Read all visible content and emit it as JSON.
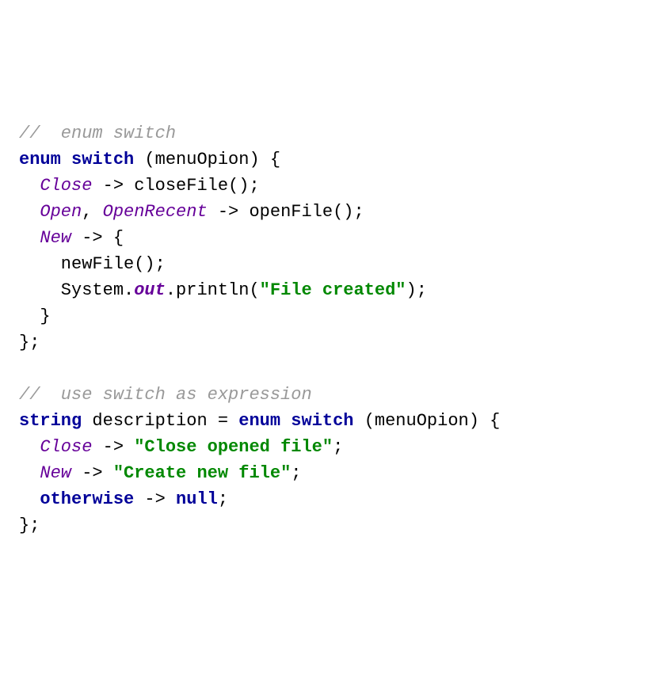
{
  "code": {
    "comment1": "//  enum switch",
    "line2_kw1": "enum",
    "line2_kw2": "switch",
    "line2_rest": " (menuOpion) {",
    "line3_enum": "Close",
    "line3_rest": " -> closeFile();",
    "line4_enum1": "Open",
    "line4_sep": ", ",
    "line4_enum2": "OpenRecent",
    "line4_rest": " -> openFile();",
    "line5_enum": "New",
    "line5_rest": " -> {",
    "line6": "    newFile();",
    "line7_pre": "    System.",
    "line7_field": "out",
    "line7_mid": ".println(",
    "line7_str": "\"File created\"",
    "line7_end": ");",
    "line8": "  }",
    "line9": "};",
    "blank": "",
    "comment2": "//  use switch as expression",
    "line12_kw1": "string",
    "line12_var": " description = ",
    "line12_kw2": "enum",
    "line12_kw3": "switch",
    "line12_rest": " (menuOpion) {",
    "line13_enum": "Close",
    "line13_arrow": " -> ",
    "line13_str": "\"Close opened file\"",
    "line13_end": ";",
    "line14_enum": "New",
    "line14_arrow": " -> ",
    "line14_str": "\"Create new file\"",
    "line14_end": ";",
    "line15_kw1": "otherwise",
    "line15_arrow": " -> ",
    "line15_kw2": "null",
    "line15_end": ";",
    "line16": "};"
  }
}
